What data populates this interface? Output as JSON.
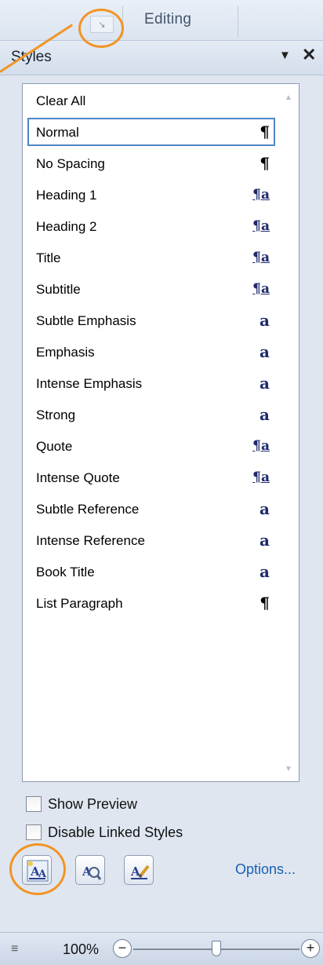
{
  "ribbon": {
    "group_label": "Editing",
    "launcher_icon": "dialog-launcher-icon"
  },
  "pane": {
    "title": "Styles",
    "menu_icon": "▼",
    "close_icon": "✕"
  },
  "styles": [
    {
      "name": "Clear All",
      "glyph": "",
      "kind": "none"
    },
    {
      "name": "Normal",
      "glyph": "¶",
      "kind": "paragraph",
      "selected": true
    },
    {
      "name": "No Spacing",
      "glyph": "¶",
      "kind": "paragraph"
    },
    {
      "name": "Heading 1",
      "glyph": "¶a",
      "kind": "linked"
    },
    {
      "name": "Heading 2",
      "glyph": "¶a",
      "kind": "linked"
    },
    {
      "name": "Title",
      "glyph": "¶a",
      "kind": "linked"
    },
    {
      "name": "Subtitle",
      "glyph": "¶a",
      "kind": "linked"
    },
    {
      "name": "Subtle Emphasis",
      "glyph": "a",
      "kind": "character"
    },
    {
      "name": "Emphasis",
      "glyph": "a",
      "kind": "character"
    },
    {
      "name": "Intense Emphasis",
      "glyph": "a",
      "kind": "character"
    },
    {
      "name": "Strong",
      "glyph": "a",
      "kind": "character"
    },
    {
      "name": "Quote",
      "glyph": "¶a",
      "kind": "linked"
    },
    {
      "name": "Intense Quote",
      "glyph": "¶a",
      "kind": "linked"
    },
    {
      "name": "Subtle Reference",
      "glyph": "a",
      "kind": "character"
    },
    {
      "name": "Intense Reference",
      "glyph": "a",
      "kind": "character"
    },
    {
      "name": "Book Title",
      "glyph": "a",
      "kind": "character"
    },
    {
      "name": "List Paragraph",
      "glyph": "¶",
      "kind": "paragraph"
    }
  ],
  "options": {
    "show_preview": {
      "label": "Show Preview",
      "checked": false
    },
    "disable_linked": {
      "label": "Disable Linked Styles",
      "checked": false
    }
  },
  "buttons": {
    "new_style_icon": "new-style-icon",
    "style_inspector_icon": "style-inspector-icon",
    "manage_styles_icon": "manage-styles-icon",
    "options_label": "Options..."
  },
  "status": {
    "zoom_level": "100%",
    "zoom_out": "−",
    "zoom_in": "+",
    "zoom_fraction": 0.5
  },
  "colors": {
    "highlight": "#f29424",
    "selection": "#4f86c6",
    "link": "#1a5fb4"
  }
}
